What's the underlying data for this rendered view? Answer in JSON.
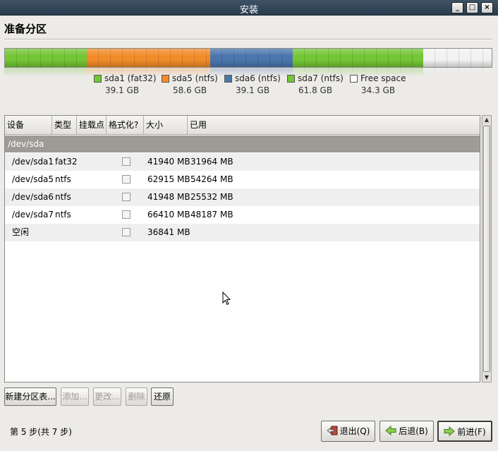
{
  "window": {
    "title": "安装",
    "controls": [
      "_",
      "□",
      "×"
    ]
  },
  "page": {
    "heading": "准备分区"
  },
  "partition_bar": {
    "segments": [
      {
        "name": "sda1",
        "color": "#73c635",
        "fraction": 0.168
      },
      {
        "name": "sda5",
        "color": "#f28c29",
        "fraction": 0.254
      },
      {
        "name": "sda6",
        "color": "#4a76ad",
        "fraction": 0.169
      },
      {
        "name": "sda7",
        "color": "#73c635",
        "fraction": 0.268
      },
      {
        "name": "free",
        "color": "#f2f2f2",
        "fraction": 0.141
      }
    ]
  },
  "legend": [
    {
      "label": "sda1 (fat32)",
      "size": "39.1 GB",
      "color": "#73c635"
    },
    {
      "label": "sda5 (ntfs)",
      "size": "58.6 GB",
      "color": "#f28c29"
    },
    {
      "label": "sda6 (ntfs)",
      "size": "39.1 GB",
      "color": "#4a76ad"
    },
    {
      "label": "sda7 (ntfs)",
      "size": "61.8 GB",
      "color": "#73c635"
    },
    {
      "label": "Free space",
      "size": "34.3 GB",
      "color": "#ffffff"
    }
  ],
  "table": {
    "columns": [
      "设备",
      "类型",
      "挂载点",
      "格式化?",
      "大小",
      "已用"
    ],
    "group": "/dev/sda",
    "rows": [
      {
        "device": "/dev/sda1",
        "type": "fat32",
        "mount": "",
        "size": "41940 MB",
        "used": "31964 MB"
      },
      {
        "device": "/dev/sda5",
        "type": "ntfs",
        "mount": "",
        "size": "62915 MB",
        "used": "54264 MB"
      },
      {
        "device": "/dev/sda6",
        "type": "ntfs",
        "mount": "",
        "size": "41948 MB",
        "used": "25532 MB"
      },
      {
        "device": "/dev/sda7",
        "type": "ntfs",
        "mount": "",
        "size": "66410 MB",
        "used": "48187 MB"
      },
      {
        "device": "空闲",
        "type": "",
        "mount": "",
        "size": "36841 MB",
        "used": ""
      }
    ]
  },
  "actions": {
    "new_table": "新建分区表...",
    "add": "添加...",
    "edit": "更改...",
    "delete": "删除",
    "revert": "还原"
  },
  "footer": {
    "step": "第 5 步(共 7 步)",
    "quit": "退出(Q)",
    "back": "后退(B)",
    "forward": "前进(F)"
  }
}
